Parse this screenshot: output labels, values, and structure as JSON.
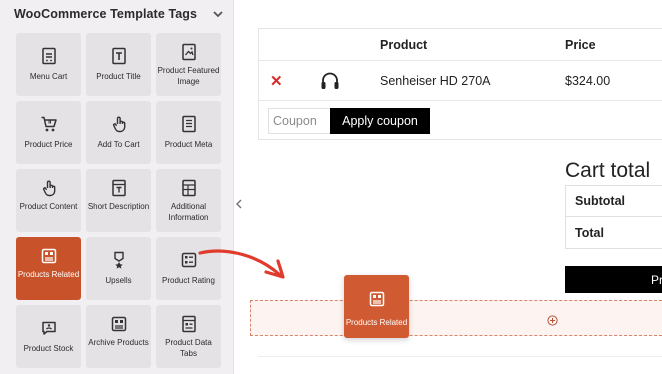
{
  "panel": {
    "title": "WooCommerce Template Tags",
    "tiles": [
      {
        "label": "Menu Cart",
        "icon": "menu-cart-icon"
      },
      {
        "label": "Product Title",
        "icon": "product-title-icon"
      },
      {
        "label": "Product Featured Image",
        "icon": "featured-image-icon"
      },
      {
        "label": "Product Price",
        "icon": "cart-icon"
      },
      {
        "label": "Add To Cart",
        "icon": "pointer-hand-icon"
      },
      {
        "label": "Product Meta",
        "icon": "document-icon"
      },
      {
        "label": "Product Content",
        "icon": "pointer-hand-icon"
      },
      {
        "label": "Short Description",
        "icon": "short-description-icon"
      },
      {
        "label": "Additional Information",
        "icon": "table-icon"
      },
      {
        "label": "Products Related",
        "icon": "products-grid-icon",
        "active": true
      },
      {
        "label": "Upsells",
        "icon": "medal-icon"
      },
      {
        "label": "Product Rating",
        "icon": "rating-list-icon"
      },
      {
        "label": "Product Stock",
        "icon": "stock-chat-icon"
      },
      {
        "label": "Archive Products",
        "icon": "products-grid-icon"
      },
      {
        "label": "Product Data Tabs",
        "icon": "data-tabs-icon"
      }
    ]
  },
  "cart": {
    "columns": {
      "product": "Product",
      "price": "Price"
    },
    "items": [
      {
        "remove": "✕",
        "name": "Senheiser HD 270A",
        "price": "$324.00",
        "thumb_icon": "headphones-icon"
      }
    ],
    "coupon_placeholder": "Coupon",
    "apply_label": "Apply coupon"
  },
  "totals": {
    "title": "Cart total",
    "rows": [
      "Subtotal",
      "Total"
    ],
    "checkout_label": "Pr"
  },
  "drag": {
    "label": "Products Related"
  },
  "colors": {
    "accent": "#c8532b",
    "arrow": "#e03b2c",
    "panel_bg": "#f1eff1",
    "tile_bg": "#e5e2e5"
  }
}
